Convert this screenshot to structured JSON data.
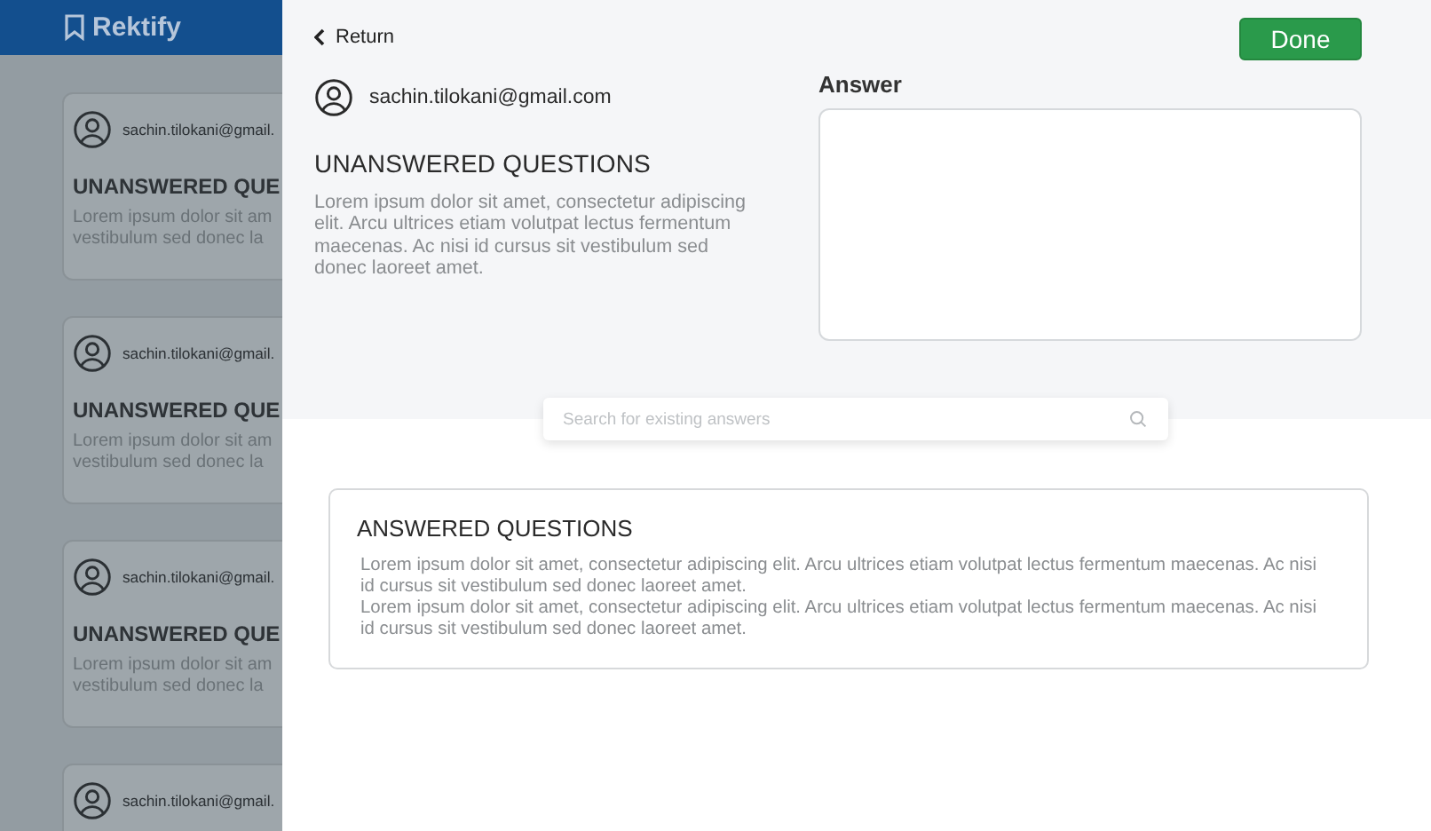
{
  "app": {
    "name": "Rektify"
  },
  "background_cards": [
    {
      "email": "sachin.tilokani@gmail.",
      "title": "UNANSWERED QUE",
      "lines": [
        "Lorem ipsum dolor sit am",
        "vestibulum sed donec la"
      ]
    },
    {
      "email": "sachin.tilokani@gmail.",
      "title": "UNANSWERED QUE",
      "lines": [
        "Lorem ipsum dolor sit am",
        "vestibulum sed donec la"
      ]
    },
    {
      "email": "sachin.tilokani@gmail.",
      "title": "UNANSWERED QUE",
      "lines": [
        "Lorem ipsum dolor sit am",
        "vestibulum sed donec la"
      ]
    },
    {
      "email": "sachin.tilokani@gmail."
    }
  ],
  "panel": {
    "return_label": "Return",
    "done_label": "Done",
    "question": {
      "email": "sachin.tilokani@gmail.com",
      "title": "UNANSWERED QUESTIONS",
      "body": "Lorem ipsum dolor sit amet, consectetur adipiscing elit. Arcu ultrices etiam volutpat lectus fermentum maecenas. Ac nisi id cursus sit vestibulum sed donec laoreet amet."
    },
    "answer_label": "Answer",
    "search": {
      "placeholder": "Search for existing answers"
    },
    "answered": {
      "title": "ANSWERED QUESTIONS",
      "paragraphs": [
        "Lorem ipsum dolor sit amet, consectetur adipiscing elit. Arcu ultrices etiam volutpat lectus fermentum maecenas. Ac nisi id cursus sit vestibulum sed donec laoreet amet.",
        "Lorem ipsum dolor sit amet, consectetur adipiscing elit. Arcu ultrices etiam volutpat lectus fermentum maecenas. Ac nisi id cursus sit vestibulum sed donec laoreet amet."
      ]
    }
  }
}
